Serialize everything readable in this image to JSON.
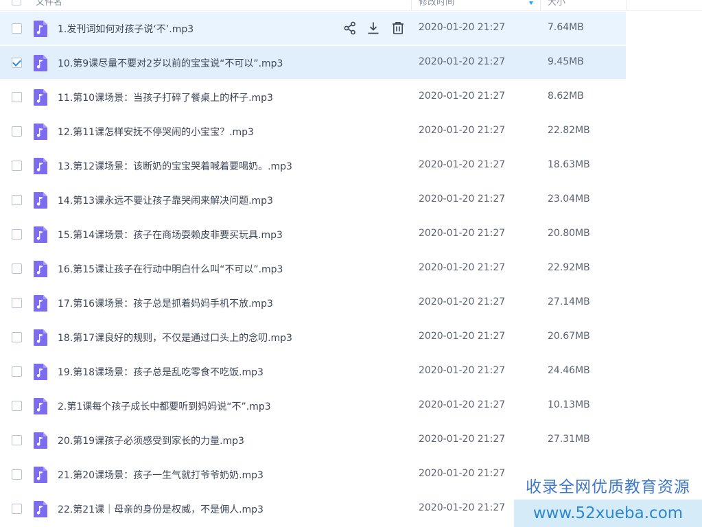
{
  "header": {
    "name_label": "文件名",
    "time_label": "修改时间",
    "size_label": "大小"
  },
  "colors": {
    "accent": "#06a7ff",
    "row_hover": "#e9f4fe",
    "row_selected": "#e1effd",
    "audio_icon": "#7b6cf0",
    "checkbox_check": "#1f8cf2"
  },
  "row_actions": {
    "share": "share-icon",
    "download": "download-icon",
    "delete": "trash-icon"
  },
  "files": [
    {
      "name": "1.发刊词如何对孩子说‘不’.mp3",
      "time": "2020-01-20 21:27",
      "size": "7.64MB",
      "checked": false,
      "state": "hover",
      "icon": "audio-file-icon"
    },
    {
      "name": "10.第9课尽量不要对2岁以前的宝宝说“不可以”.mp3",
      "time": "2020-01-20 21:27",
      "size": "9.45MB",
      "checked": true,
      "state": "selected",
      "icon": "audio-file-icon"
    },
    {
      "name": "11.第10课场景：当孩子打碎了餐桌上的杯子.mp3",
      "time": "2020-01-20 21:27",
      "size": "8.62MB",
      "checked": false,
      "state": "",
      "icon": "audio-file-icon"
    },
    {
      "name": "12.第11课怎样安抚不停哭闹的小宝宝？.mp3",
      "time": "2020-01-20 21:27",
      "size": "22.82MB",
      "checked": false,
      "state": "",
      "icon": "audio-file-icon"
    },
    {
      "name": "13.第12课场景：该断奶的宝宝哭着喊着要喝奶。.mp3",
      "time": "2020-01-20 21:27",
      "size": "18.63MB",
      "checked": false,
      "state": "",
      "icon": "audio-file-icon"
    },
    {
      "name": "14.第13课永远不要让孩子靠哭闹来解决问题.mp3",
      "time": "2020-01-20 21:27",
      "size": "23.04MB",
      "checked": false,
      "state": "",
      "icon": "audio-file-icon"
    },
    {
      "name": "15.第14课场景：孩子在商场耍赖皮非要买玩具.mp3",
      "time": "2020-01-20 21:27",
      "size": "20.80MB",
      "checked": false,
      "state": "",
      "icon": "audio-file-icon"
    },
    {
      "name": "16.第15课让孩子在行动中明白什么叫“不可以”.mp3",
      "time": "2020-01-20 21:27",
      "size": "22.92MB",
      "checked": false,
      "state": "",
      "icon": "audio-file-icon"
    },
    {
      "name": "17.第16课场景：孩子总是抓着妈妈手机不放.mp3",
      "time": "2020-01-20 21:27",
      "size": "27.14MB",
      "checked": false,
      "state": "",
      "icon": "audio-file-icon"
    },
    {
      "name": "18.第17课良好的规则，不仅是通过口头上的念叨.mp3",
      "time": "2020-01-20 21:27",
      "size": "20.67MB",
      "checked": false,
      "state": "",
      "icon": "audio-file-icon"
    },
    {
      "name": "19.第18课场景：孩子总是乱吃零食不吃饭.mp3",
      "time": "2020-01-20 21:27",
      "size": "24.46MB",
      "checked": false,
      "state": "",
      "icon": "audio-file-icon"
    },
    {
      "name": "2.第1课每个孩子成长中都要听到妈妈说“不”.mp3",
      "time": "2020-01-20 21:27",
      "size": "10.13MB",
      "checked": false,
      "state": "",
      "icon": "audio-file-icon"
    },
    {
      "name": "20.第19课孩子必须感受到家长的力量.mp3",
      "time": "2020-01-20 21:27",
      "size": "27.31MB",
      "checked": false,
      "state": "",
      "icon": "audio-file-icon"
    },
    {
      "name": "21.第20课场景：孩子一生气就打爷爷奶奶.mp3",
      "time": "2020-01-20 21:27",
      "size": "",
      "checked": false,
      "state": "",
      "icon": "audio-file-icon"
    },
    {
      "name": "22.第21课｜母亲的身份是权威，不是佣人.mp3",
      "time": "2020-01-20 21:27",
      "size": "",
      "checked": false,
      "state": "",
      "icon": "audio-file-icon"
    }
  ],
  "watermark": {
    "line1": "收录全网优质教育资源",
    "line2": "www.52xueba.com"
  }
}
